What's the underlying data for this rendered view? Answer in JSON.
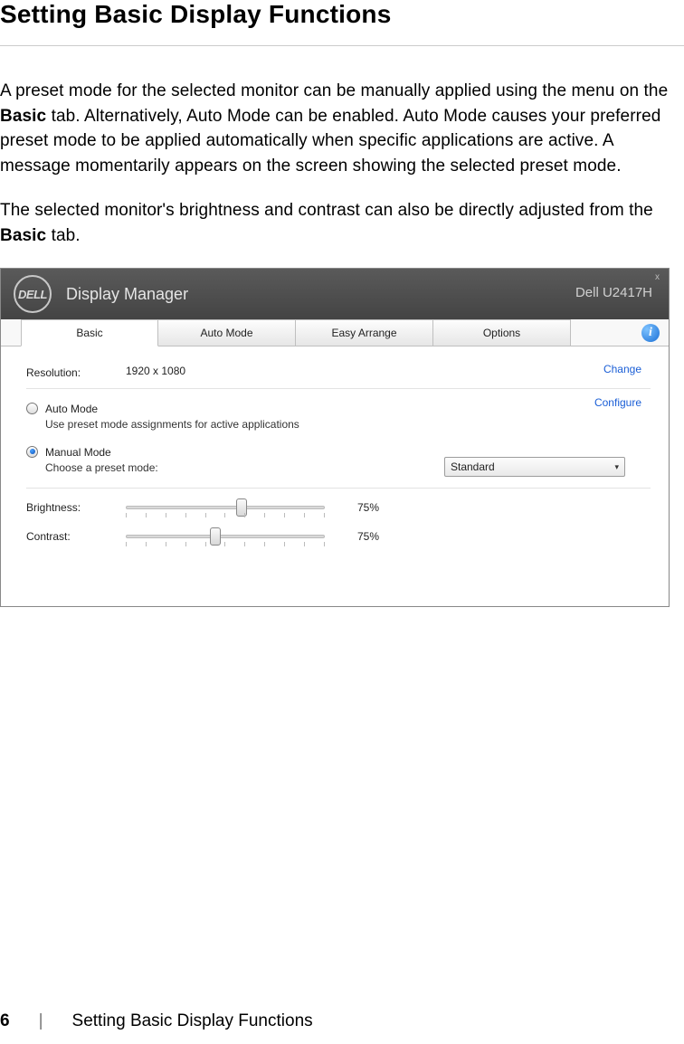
{
  "page": {
    "title": "Setting Basic Display Functions",
    "paragraph1_pre": "A preset mode for the selected monitor can be manually applied using the menu on the ",
    "paragraph1_bold": "Basic",
    "paragraph1_post": " tab. Alternatively, Auto Mode can be enabled. Auto Mode causes your preferred preset mode to be applied automatically when specific applications are active. A message momentarily appears on the screen showing the selected preset mode.",
    "paragraph2_pre": "The selected monitor's brightness and contrast can also be directly adjusted from the ",
    "paragraph2_bold": "Basic",
    "paragraph2_post": " tab.",
    "number": "6",
    "footer_sep": "|",
    "footer_text": "Setting Basic Display Functions"
  },
  "app": {
    "logo_text": "DELL",
    "title": "Display Manager",
    "monitor": "Dell U2417H",
    "close": "x",
    "tabs": {
      "basic": "Basic",
      "auto_mode": "Auto Mode",
      "easy_arrange": "Easy Arrange",
      "options": "Options"
    },
    "info": "i",
    "resolution": {
      "label": "Resolution:",
      "value": "1920 x 1080",
      "link": "Change"
    },
    "modes": {
      "configure": "Configure",
      "auto": {
        "title": "Auto Mode",
        "sub": "Use preset mode assignments for active applications"
      },
      "manual": {
        "title": "Manual Mode",
        "sub": "Choose a preset mode:"
      },
      "preset_value": "Standard",
      "caret": "▾"
    },
    "brightness": {
      "label": "Brightness:",
      "value_text": "75%",
      "percent": 58
    },
    "contrast": {
      "label": "Contrast:",
      "value_text": "75%",
      "percent": 45
    }
  }
}
